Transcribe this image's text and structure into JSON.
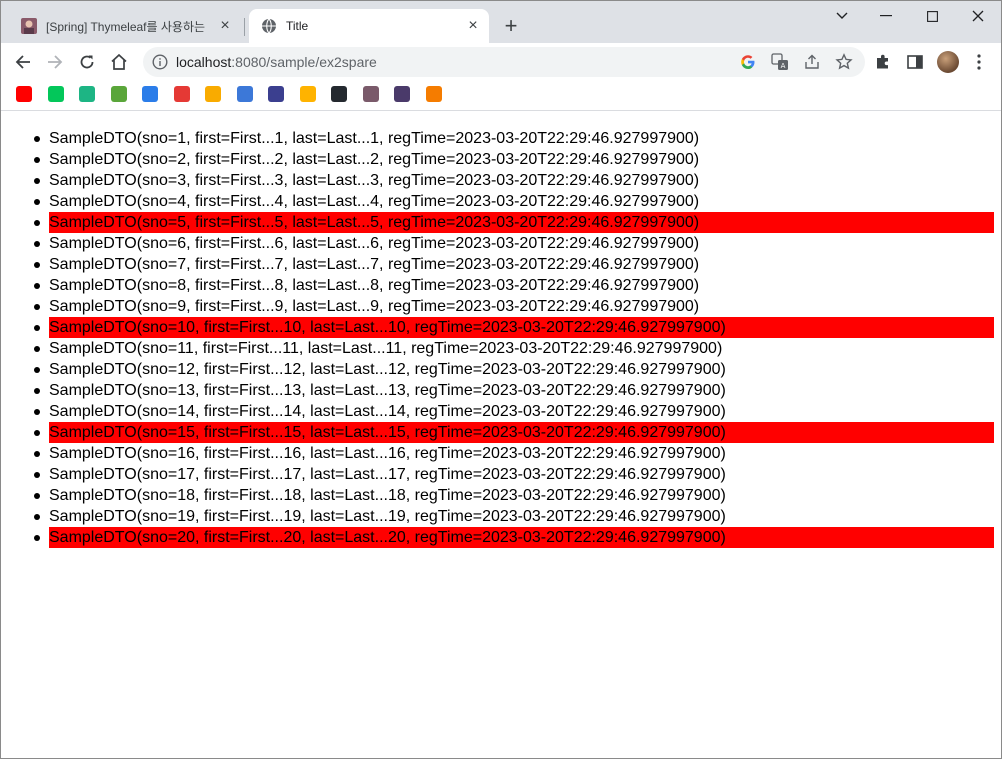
{
  "browser": {
    "tabs": [
      {
        "title": "[Spring] Thymeleaf를 사용하는 코",
        "active": false,
        "favicon": "avatar-favicon-icon"
      },
      {
        "title": "Title",
        "active": true,
        "favicon": "globe-icon"
      }
    ],
    "new_tab_label": "+",
    "close_label": "×",
    "url_host": "localhost",
    "url_path": ":8080/sample/ex2spare"
  },
  "bookmarks": [
    {
      "icon": "youtube-icon",
      "color": "#ff0000"
    },
    {
      "icon": "naver-icon",
      "color": "#03c75a"
    },
    {
      "icon": "green-circle-icon",
      "color": "#1db584"
    },
    {
      "icon": "leaf-icon",
      "color": "#5aa63a"
    },
    {
      "icon": "feather-icon",
      "color": "#2b7de9"
    },
    {
      "icon": "lifebuoy-icon",
      "color": "#e53935"
    },
    {
      "icon": "classroom-icon",
      "color": "#f9ab00"
    },
    {
      "icon": "blue-box-icon",
      "color": "#3c78d8"
    },
    {
      "icon": "owl-icon",
      "color": "#3b3f8f"
    },
    {
      "icon": "umbrella-icon",
      "color": "#ffb300"
    },
    {
      "icon": "github-icon",
      "color": "#24292f"
    },
    {
      "icon": "avatar-icon",
      "color": "#7a5a6a"
    },
    {
      "icon": "character-icon",
      "color": "#4a3a6a"
    },
    {
      "icon": "orange-cube-icon",
      "color": "#f57c00"
    }
  ],
  "items": [
    {
      "text": "SampleDTO(sno=1, first=First...1, last=Last...1, regTime=2023-03-20T22:29:46.927997900)",
      "highlight": false
    },
    {
      "text": "SampleDTO(sno=2, first=First...2, last=Last...2, regTime=2023-03-20T22:29:46.927997900)",
      "highlight": false
    },
    {
      "text": "SampleDTO(sno=3, first=First...3, last=Last...3, regTime=2023-03-20T22:29:46.927997900)",
      "highlight": false
    },
    {
      "text": "SampleDTO(sno=4, first=First...4, last=Last...4, regTime=2023-03-20T22:29:46.927997900)",
      "highlight": false
    },
    {
      "text": "SampleDTO(sno=5, first=First...5, last=Last...5, regTime=2023-03-20T22:29:46.927997900)",
      "highlight": true
    },
    {
      "text": "SampleDTO(sno=6, first=First...6, last=Last...6, regTime=2023-03-20T22:29:46.927997900)",
      "highlight": false
    },
    {
      "text": "SampleDTO(sno=7, first=First...7, last=Last...7, regTime=2023-03-20T22:29:46.927997900)",
      "highlight": false
    },
    {
      "text": "SampleDTO(sno=8, first=First...8, last=Last...8, regTime=2023-03-20T22:29:46.927997900)",
      "highlight": false
    },
    {
      "text": "SampleDTO(sno=9, first=First...9, last=Last...9, regTime=2023-03-20T22:29:46.927997900)",
      "highlight": false
    },
    {
      "text": "SampleDTO(sno=10, first=First...10, last=Last...10, regTime=2023-03-20T22:29:46.927997900)",
      "highlight": true
    },
    {
      "text": "SampleDTO(sno=11, first=First...11, last=Last...11, regTime=2023-03-20T22:29:46.927997900)",
      "highlight": false
    },
    {
      "text": "SampleDTO(sno=12, first=First...12, last=Last...12, regTime=2023-03-20T22:29:46.927997900)",
      "highlight": false
    },
    {
      "text": "SampleDTO(sno=13, first=First...13, last=Last...13, regTime=2023-03-20T22:29:46.927997900)",
      "highlight": false
    },
    {
      "text": "SampleDTO(sno=14, first=First...14, last=Last...14, regTime=2023-03-20T22:29:46.927997900)",
      "highlight": false
    },
    {
      "text": "SampleDTO(sno=15, first=First...15, last=Last...15, regTime=2023-03-20T22:29:46.927997900)",
      "highlight": true
    },
    {
      "text": "SampleDTO(sno=16, first=First...16, last=Last...16, regTime=2023-03-20T22:29:46.927997900)",
      "highlight": false
    },
    {
      "text": "SampleDTO(sno=17, first=First...17, last=Last...17, regTime=2023-03-20T22:29:46.927997900)",
      "highlight": false
    },
    {
      "text": "SampleDTO(sno=18, first=First...18, last=Last...18, regTime=2023-03-20T22:29:46.927997900)",
      "highlight": false
    },
    {
      "text": "SampleDTO(sno=19, first=First...19, last=Last...19, regTime=2023-03-20T22:29:46.927997900)",
      "highlight": false
    },
    {
      "text": "SampleDTO(sno=20, first=First...20, last=Last...20, regTime=2023-03-20T22:29:46.927997900)",
      "highlight": true
    }
  ],
  "highlight_color": "#ff0000"
}
